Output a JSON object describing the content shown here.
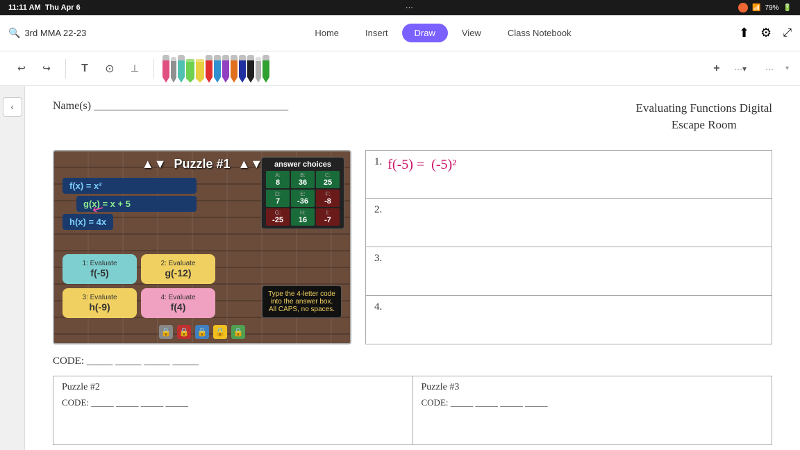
{
  "statusBar": {
    "time": "11:11 AM",
    "day": "Thu Apr 6",
    "battery": "79%"
  },
  "navBar": {
    "searchText": "3rd MMA 22-23",
    "tabs": [
      {
        "label": "Home",
        "active": false
      },
      {
        "label": "Insert",
        "active": false
      },
      {
        "label": "Draw",
        "active": true
      },
      {
        "label": "View",
        "active": false
      },
      {
        "label": "Class Notebook",
        "active": false
      }
    ]
  },
  "toolbar": {
    "undoLabel": "↩",
    "redoLabel": "↪",
    "textLabel": "T",
    "moreLabel": "···",
    "addLabel": "+",
    "overflowLabel": "···"
  },
  "pens": [
    {
      "color": "#e05080",
      "type": "felt"
    },
    {
      "color": "#888888",
      "type": "pencil"
    },
    {
      "color": "#60d0c0",
      "type": "felt"
    },
    {
      "color": "#80e060",
      "type": "highlighter"
    },
    {
      "color": "#f0e040",
      "type": "highlighter"
    },
    {
      "color": "#e04040",
      "type": "felt"
    },
    {
      "color": "#40a0e0",
      "type": "felt"
    },
    {
      "color": "#c050e0",
      "type": "felt"
    },
    {
      "color": "#e08030",
      "type": "felt"
    },
    {
      "color": "#4040c0",
      "type": "felt"
    },
    {
      "color": "#202020",
      "type": "felt"
    },
    {
      "color": "#a0a0a0",
      "type": "pencil"
    },
    {
      "color": "#50c050",
      "type": "felt"
    }
  ],
  "document": {
    "nameLine": "Name(s) ___________________________________",
    "title": "Evaluating Functions Digital\nEscape Room",
    "puzzle1": {
      "title": "Puzzle #1",
      "functions": {
        "fx": "f(x) = x²",
        "hx": "h(x) = 4x",
        "gx": "g(x) = x + 5"
      },
      "answerChoices": {
        "title": "answer choices",
        "cells": [
          {
            "label": "A:",
            "val": "8"
          },
          {
            "label": "B:",
            "val": "36"
          },
          {
            "label": "C:",
            "val": "25"
          },
          {
            "label": "D:",
            "val": "7"
          },
          {
            "label": "E:",
            "val": "-36"
          },
          {
            "label": "F:",
            "val": "-8"
          },
          {
            "label": "G:",
            "val": "-25"
          },
          {
            "label": "H:",
            "val": "16"
          },
          {
            "label": "I:",
            "val": "-7"
          }
        ]
      },
      "evalItems": [
        {
          "num": "1:",
          "label": "Evaluate",
          "func": "f(-5)",
          "color": "teal"
        },
        {
          "num": "2:",
          "label": "Evaluate",
          "func": "g(-12)",
          "color": "yellow"
        },
        {
          "num": "3:",
          "label": "Evaluate",
          "func": "h(-9)",
          "color": "yellow"
        },
        {
          "num": "4:",
          "label": "Evaluate",
          "func": "f(4)",
          "color": "pink"
        }
      ],
      "codeBoxText": "Type the 4-letter code into the answer box. All CAPS, no spaces.",
      "locks": [
        "🔒",
        "🔒",
        "🔒",
        "🔒",
        "🔒"
      ]
    },
    "answers": [
      {
        "num": "1.",
        "content": "f(-5) = (-5)²",
        "handwritten": true
      },
      {
        "num": "2.",
        "content": "",
        "handwritten": false
      },
      {
        "num": "3.",
        "content": "",
        "handwritten": false
      },
      {
        "num": "4.",
        "content": "",
        "handwritten": false
      }
    ],
    "codeLine": "CODE: _____ _____ _____ _____",
    "puzzle2": {
      "title": "Puzzle #2",
      "codeLine": "CODE: _____ _____ _____ _____"
    },
    "puzzle3": {
      "title": "Puzzle #3",
      "codeLine": "CODE: _____ _____ _____ _____"
    }
  }
}
